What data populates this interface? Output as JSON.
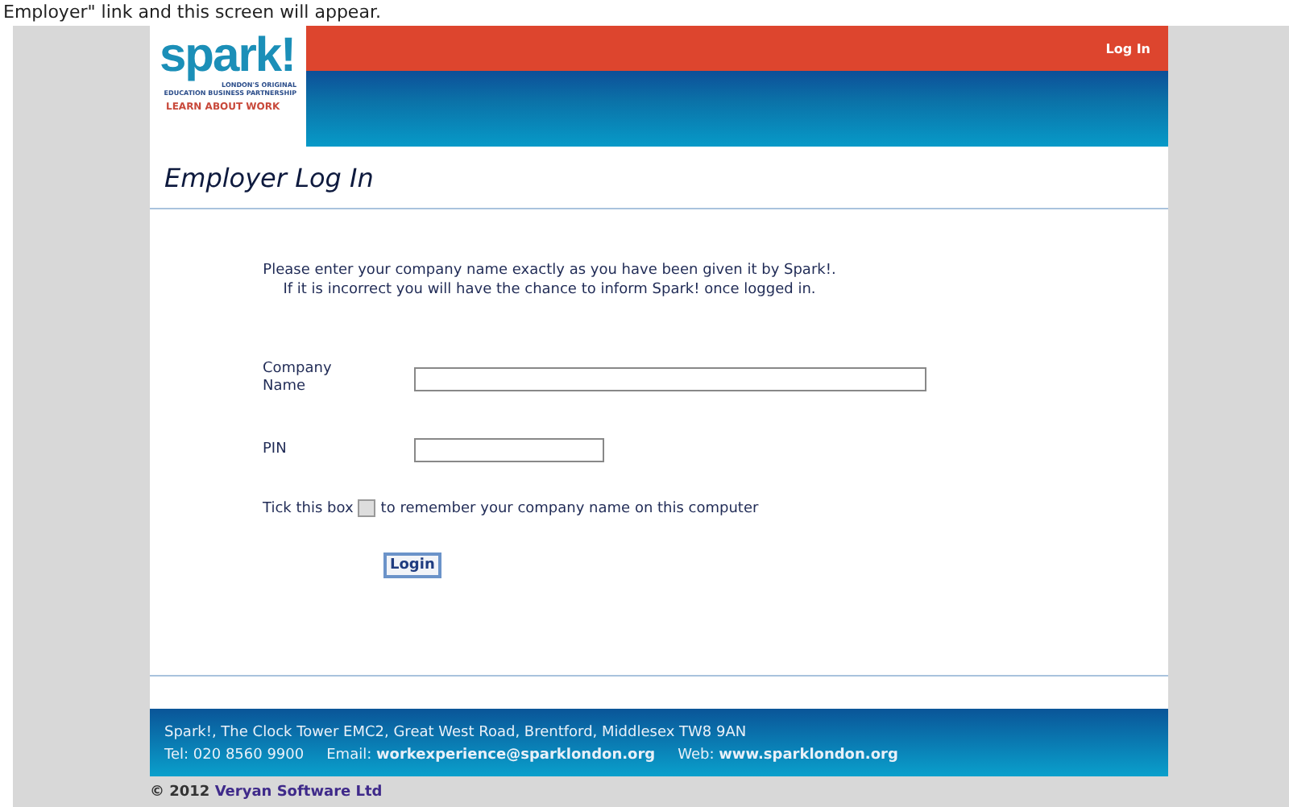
{
  "caption": "Employer\" link and this screen will appear.",
  "logo": {
    "brand": "spark!",
    "tagline_1": "LONDON'S ORIGINAL",
    "tagline_2": "EDUCATION BUSINESS PARTNERSHIP",
    "slogan": "LEARN ABOUT WORK"
  },
  "nav": {
    "link": "Log In"
  },
  "page_title": "Employer Log In",
  "intro": [
    "Please enter your company name exactly as you have been given it by Spark!.",
    "If it is incorrect you will have the chance to inform Spark! once logged in."
  ],
  "fields": [
    {
      "label": "Company Name",
      "kind": "wide"
    },
    {
      "label": "PIN",
      "kind": "short"
    }
  ],
  "remember": {
    "before": "Tick this box",
    "after": "to remember your company name on this computer",
    "checked": false
  },
  "button": "Login",
  "footer": {
    "address": "Spark!, The Clock Tower EMC2, Great West Road, Brentford, Middlesex TW8 9AN",
    "tel": "Tel: 020 8560 9900",
    "email": "Email: **workexperience@sparklondon.org**",
    "web": "Web: **www.sparklondon.org**"
  },
  "copyright": {
    "year": "© 2012",
    "company": "Veryan Software Ltd"
  }
}
